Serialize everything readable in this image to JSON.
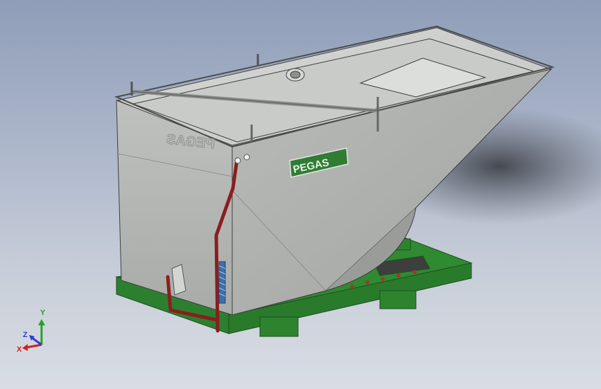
{
  "viewport": {
    "background_top": "#8f9db8",
    "background_bottom": "#d9dde3"
  },
  "model": {
    "brand_label": "PEGAS",
    "mirrored_brand_label": "PEGAS",
    "colors": {
      "hopper": "#b4b6b4",
      "frame": "#2f8a31",
      "lever": "#8a1e1e",
      "badge": "#2f7d32",
      "spring": "#3f6ea8"
    }
  },
  "triad": {
    "x_label": "X",
    "y_label": "Y",
    "z_label": "Z",
    "x_color": "#d11f1f",
    "y_color": "#22a22a",
    "z_color": "#2a3fd0"
  }
}
